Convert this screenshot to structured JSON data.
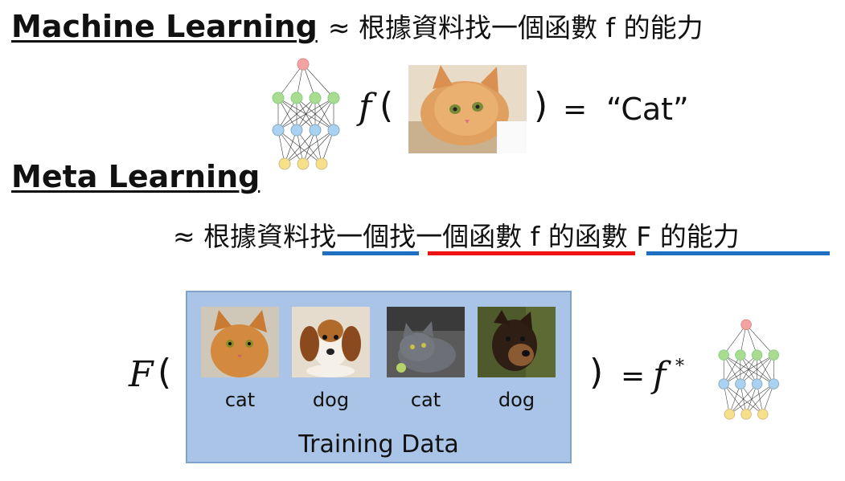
{
  "ml": {
    "title": "Machine Learning",
    "approx_text": "≈ 根據資料找一個函數 f 的能力"
  },
  "eq1": {
    "func": "f",
    "open": "(",
    "close": ")",
    "equals": "=",
    "result": "“Cat”"
  },
  "meta": {
    "title": "Meta Learning",
    "approx": "≈",
    "seg1": "根據資料",
    "seg2": "找一個",
    "seg3": "找一個函數 f 的",
    "seg4": "函數 F 的能力"
  },
  "eq2": {
    "func": "F",
    "open": "(",
    "close": ")",
    "equals": "=",
    "result_base": "f",
    "result_sup": "*"
  },
  "training": {
    "caption": "Training Data",
    "items": [
      {
        "label": "cat"
      },
      {
        "label": "dog"
      },
      {
        "label": "cat"
      },
      {
        "label": "dog"
      }
    ]
  },
  "colors": {
    "blue_underline": "#1e6fbf",
    "red_underline": "#ee1111",
    "box_fill": "#a9c4e6",
    "node_top": "#f4a3a3",
    "node_green": "#a9dc8f",
    "node_blue": "#a8d1f2",
    "node_yellow": "#f7e08a"
  }
}
